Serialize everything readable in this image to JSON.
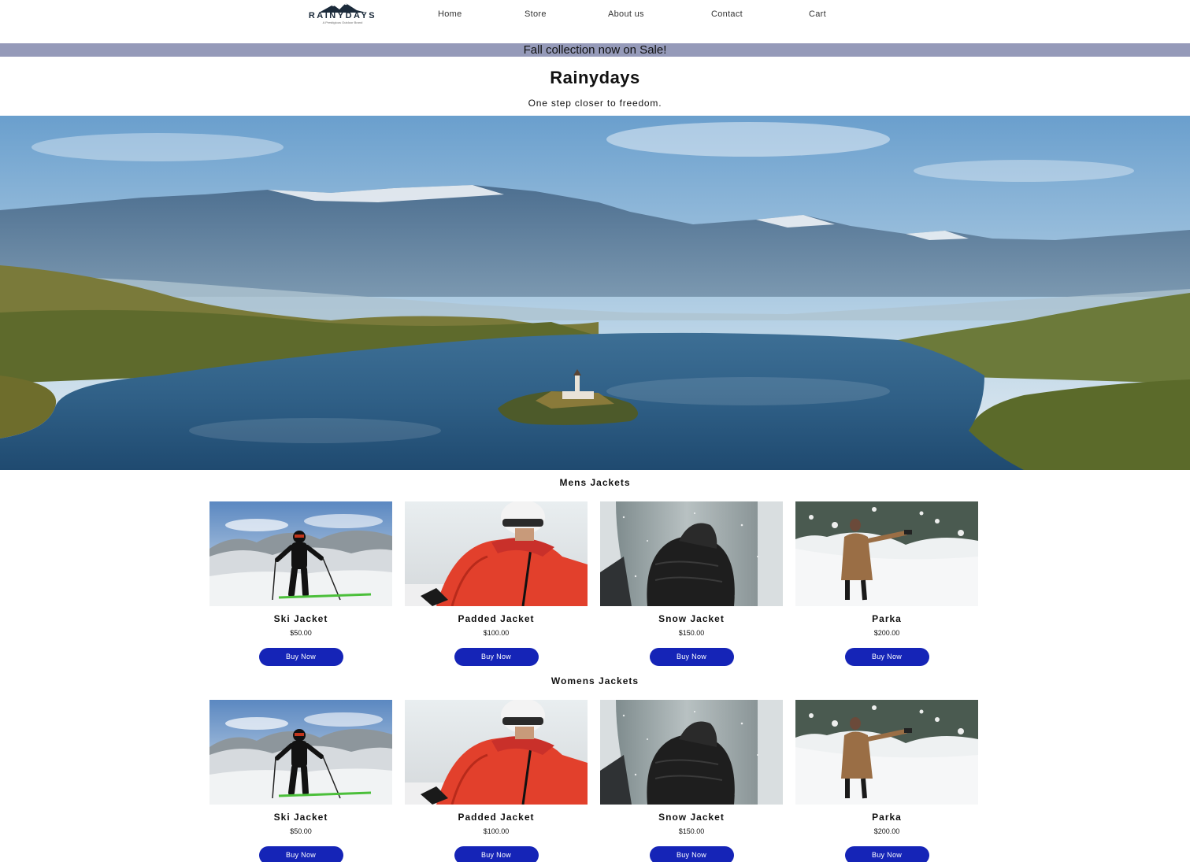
{
  "header": {
    "logo_text": "RAINYDAYS",
    "logo_tagline": "A Prestigious Outdoor Brand",
    "nav": [
      {
        "label": "Home"
      },
      {
        "label": "Store"
      },
      {
        "label": "About us"
      },
      {
        "label": "Contact"
      },
      {
        "label": "Cart"
      }
    ]
  },
  "banner": {
    "text": "Fall collection now on Sale!"
  },
  "hero": {
    "title": "Rainydays",
    "tagline": "One step closer to freedom."
  },
  "sections": [
    {
      "heading": "Mens Jackets",
      "products": [
        {
          "name": "Ski Jacket",
          "price": "$50.00",
          "button": "Buy Now",
          "image": "skier-on-snowy-mountain"
        },
        {
          "name": "Padded Jacket",
          "price": "$100.00",
          "button": "Buy Now",
          "image": "red-padded-jacket-helmet"
        },
        {
          "name": "Snow Jacket",
          "price": "$150.00",
          "button": "Buy Now",
          "image": "black-snow-jacket-in-snowfall"
        },
        {
          "name": "Parka",
          "price": "$200.00",
          "button": "Buy Now",
          "image": "woman-in-brown-parka-snow-forest"
        }
      ]
    },
    {
      "heading": "Womens Jackets",
      "products": [
        {
          "name": "Ski Jacket",
          "price": "$50.00",
          "button": "Buy Now",
          "image": "skier-on-snowy-mountain"
        },
        {
          "name": "Padded Jacket",
          "price": "$100.00",
          "button": "Buy Now",
          "image": "red-padded-jacket-helmet"
        },
        {
          "name": "Snow Jacket",
          "price": "$150.00",
          "button": "Buy Now",
          "image": "black-snow-jacket-in-snowfall"
        },
        {
          "name": "Parka",
          "price": "$200.00",
          "button": "Buy Now",
          "image": "woman-in-brown-parka-snow-forest"
        }
      ]
    }
  ],
  "colors": {
    "banner_bg": "#959ab9",
    "button_bg": "#1524b7",
    "button_text": "#ffffff"
  }
}
